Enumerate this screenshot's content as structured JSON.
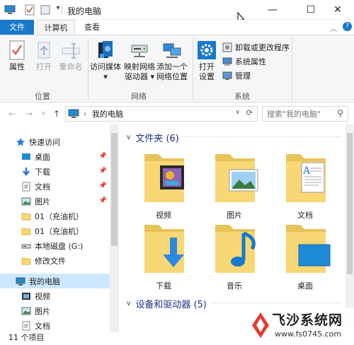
{
  "window": {
    "title": "我的电脑",
    "minimize": "—",
    "maximize": "☐",
    "close": "✕"
  },
  "tabs": [
    {
      "label": "文件"
    },
    {
      "label": "计算机"
    },
    {
      "label": "查看"
    }
  ],
  "ribbon": {
    "location_group": {
      "label": "位置",
      "buttons": [
        {
          "label": "属性",
          "icon": "checklist-icon",
          "enabled": true
        },
        {
          "label": "打开",
          "icon": "open-icon",
          "enabled": false
        },
        {
          "label": "重命名",
          "icon": "rename-icon",
          "enabled": false
        }
      ]
    },
    "network_group": {
      "label": "网络",
      "buttons": [
        {
          "label_1": "访问媒体",
          "label_2": "▾",
          "icon": "media-icon"
        },
        {
          "label_1": "映射网络",
          "label_2": "驱动器 ▾",
          "icon": "network-drive-icon"
        },
        {
          "label_1": "添加一个",
          "label_2": "网络位置",
          "icon": "network-location-icon"
        }
      ]
    },
    "system_group": {
      "label": "系统",
      "open_settings_1": "打开",
      "open_settings_2": "设置",
      "items": [
        {
          "label": "卸载或更改程序"
        },
        {
          "label": "系统属性"
        },
        {
          "label": "管理"
        }
      ]
    }
  },
  "address": {
    "path": "我的电脑",
    "search_placeholder": "搜索\"我的电脑\""
  },
  "navpane": {
    "items": [
      {
        "label": "快速访问",
        "icon": "star-icon",
        "pinned": false
      },
      {
        "label": "桌面",
        "icon": "desktop-icon",
        "pinned": true
      },
      {
        "label": "下载",
        "icon": "download-icon",
        "pinned": true
      },
      {
        "label": "文档",
        "icon": "document-icon",
        "pinned": true
      },
      {
        "label": "图片",
        "icon": "pictures-icon",
        "pinned": true
      },
      {
        "label": "01（充油机）",
        "icon": "folder-icon",
        "pinned": false
      },
      {
        "label": "01（充油机）",
        "icon": "folder-icon",
        "pinned": false
      },
      {
        "label": "本地磁盘 (G:)",
        "icon": "drive-icon",
        "pinned": false
      },
      {
        "label": "修改文件",
        "icon": "folder-icon",
        "pinned": false
      },
      {
        "label": "我的电脑",
        "icon": "computer-icon",
        "pinned": false
      },
      {
        "label": "视频",
        "icon": "videos-icon",
        "pinned": false
      },
      {
        "label": "图片",
        "icon": "pictures-icon",
        "pinned": false
      },
      {
        "label": "文档",
        "icon": "document-icon",
        "pinned": false
      }
    ]
  },
  "content": {
    "folders_header": "文件夹 (6)",
    "devices_header": "设备和驱动器 (5)",
    "folders": [
      {
        "label": "视频",
        "icon": "videos-folder-icon"
      },
      {
        "label": "图片",
        "icon": "pictures-folder-icon"
      },
      {
        "label": "文档",
        "icon": "documents-folder-icon"
      },
      {
        "label": "下载",
        "icon": "downloads-folder-icon"
      },
      {
        "label": "音乐",
        "icon": "music-folder-icon"
      },
      {
        "label": "桌面",
        "icon": "desktop-folder-icon"
      }
    ]
  },
  "status": {
    "count": "11 个项目"
  },
  "watermark": {
    "name": "飞沙系统网",
    "url": "www.fs0745.com"
  },
  "colors": {
    "accent": "#1979ca",
    "selection": "#cce8ff",
    "folder": "#f8d775",
    "header_text": "#1e3287"
  }
}
